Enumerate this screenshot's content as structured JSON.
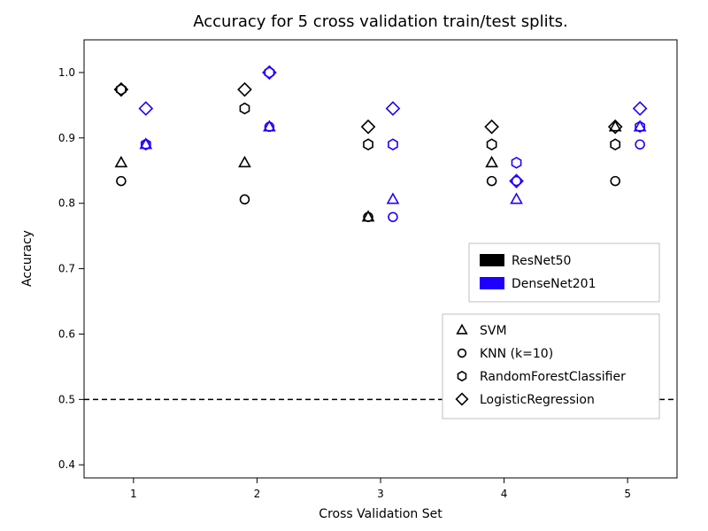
{
  "chart_data": {
    "type": "scatter",
    "title": "Accuracy for 5 cross validation train/test splits.",
    "xlabel": "Cross Validation Set",
    "ylabel": "Accuracy",
    "x_ticks": [
      1,
      2,
      3,
      4,
      5
    ],
    "y_ticks": [
      0.4,
      0.5,
      0.6,
      0.7,
      0.8,
      0.9,
      1.0
    ],
    "xlim": [
      0.6,
      5.4
    ],
    "ylim": [
      0.38,
      1.05
    ],
    "reference_line_y": 0.5,
    "color_legend": [
      {
        "name": "ResNet50",
        "color": "#000000"
      },
      {
        "name": "DenseNet201",
        "color": "#1f00ff"
      }
    ],
    "marker_legend": [
      {
        "name": "SVM",
        "marker": "triangle"
      },
      {
        "name": "KNN (k=10)",
        "marker": "circle"
      },
      {
        "name": "RandomForestClassifier",
        "marker": "hexagon"
      },
      {
        "name": "LogisticRegression",
        "marker": "diamond"
      }
    ],
    "x_offsets": {
      "ResNet50": -0.1,
      "DenseNet201": 0.1
    },
    "series": [
      {
        "backbone": "ResNet50",
        "classifier": "SVM",
        "marker": "triangle",
        "color": "#000000",
        "x": [
          1,
          2,
          3,
          4,
          5
        ],
        "y": [
          0.862,
          0.862,
          0.779,
          0.862,
          0.917
        ]
      },
      {
        "backbone": "ResNet50",
        "classifier": "KNN (k=10)",
        "marker": "circle",
        "color": "#000000",
        "x": [
          1,
          2,
          3,
          4,
          5
        ],
        "y": [
          0.834,
          0.806,
          0.779,
          0.834,
          0.834
        ]
      },
      {
        "backbone": "ResNet50",
        "classifier": "RandomForestClassifier",
        "marker": "hexagon",
        "color": "#000000",
        "x": [
          1,
          2,
          3,
          4,
          5
        ],
        "y": [
          0.974,
          0.945,
          0.89,
          0.89,
          0.89
        ]
      },
      {
        "backbone": "ResNet50",
        "classifier": "LogisticRegression",
        "marker": "diamond",
        "color": "#000000",
        "x": [
          1,
          2,
          3,
          4,
          5
        ],
        "y": [
          0.974,
          0.974,
          0.917,
          0.917,
          0.917
        ]
      },
      {
        "backbone": "DenseNet201",
        "classifier": "SVM",
        "marker": "triangle",
        "color": "#1f00ff",
        "x": [
          1,
          2,
          3,
          4,
          5
        ],
        "y": [
          0.89,
          0.917,
          0.806,
          0.806,
          0.917
        ]
      },
      {
        "backbone": "DenseNet201",
        "classifier": "KNN (k=10)",
        "marker": "circle",
        "color": "#1f00ff",
        "x": [
          1,
          2,
          3,
          4,
          5
        ],
        "y": [
          0.89,
          0.917,
          0.779,
          0.834,
          0.89
        ]
      },
      {
        "backbone": "DenseNet201",
        "classifier": "RandomForestClassifier",
        "marker": "hexagon",
        "color": "#1f00ff",
        "x": [
          1,
          2,
          3,
          4,
          5
        ],
        "y": [
          0.89,
          1.0,
          0.89,
          0.862,
          0.917
        ]
      },
      {
        "backbone": "DenseNet201",
        "classifier": "LogisticRegression",
        "marker": "diamond",
        "color": "#1f00ff",
        "x": [
          1,
          2,
          3,
          4,
          5
        ],
        "y": [
          0.945,
          1.0,
          0.945,
          0.834,
          0.945
        ]
      }
    ]
  }
}
